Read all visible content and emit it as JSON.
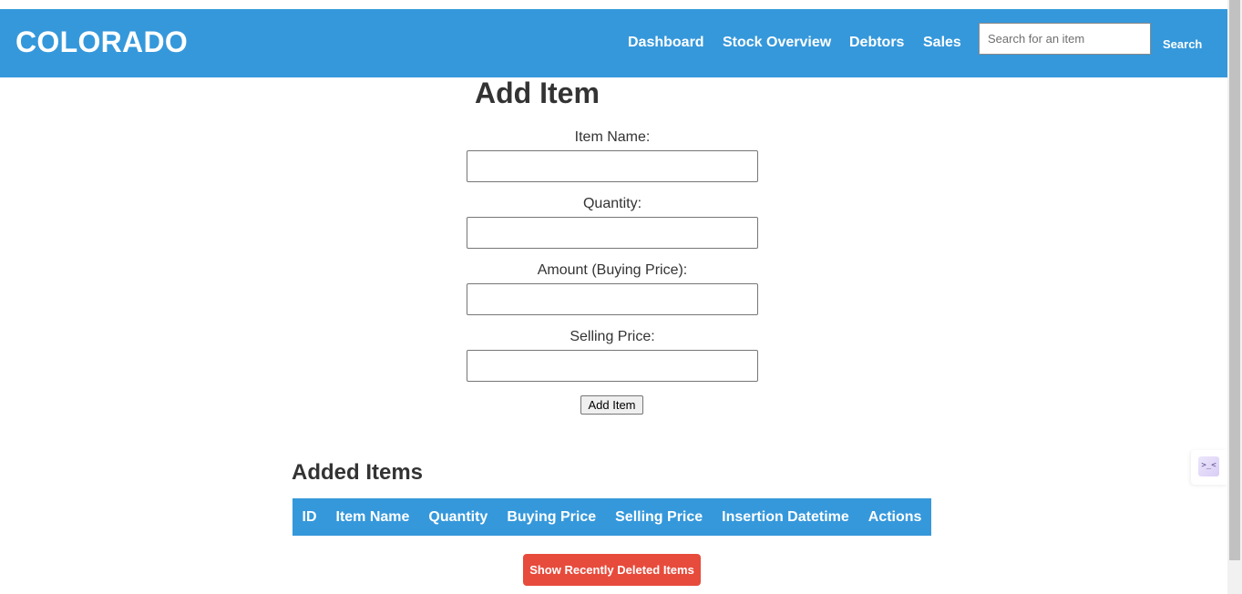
{
  "navbar": {
    "brand": "COLORADO",
    "links": [
      "Dashboard",
      "Stock Overview",
      "Debtors",
      "Sales"
    ],
    "search_placeholder": "Search for an item",
    "search_value": "",
    "search_button": "Search",
    "background_color": "#3598db"
  },
  "form": {
    "title": "Add Item",
    "fields": [
      {
        "label": "Item Name:",
        "value": ""
      },
      {
        "label": "Quantity:",
        "value": ""
      },
      {
        "label": "Amount (Buying Price):",
        "value": ""
      },
      {
        "label": "Selling Price:",
        "value": ""
      }
    ],
    "submit_label": "Add Item"
  },
  "added_items": {
    "title": "Added Items",
    "columns": [
      "ID",
      "Item Name",
      "Quantity",
      "Buying Price",
      "Selling Price",
      "Insertion Datetime",
      "Actions"
    ],
    "rows": [],
    "header_color": "#3598db"
  },
  "deleted_button": {
    "label": "Show Recently Deleted Items",
    "color": "#e74b3c"
  },
  "extension_widget": {
    "icon": "chat-extension-icon",
    "glyph": ">_<"
  }
}
